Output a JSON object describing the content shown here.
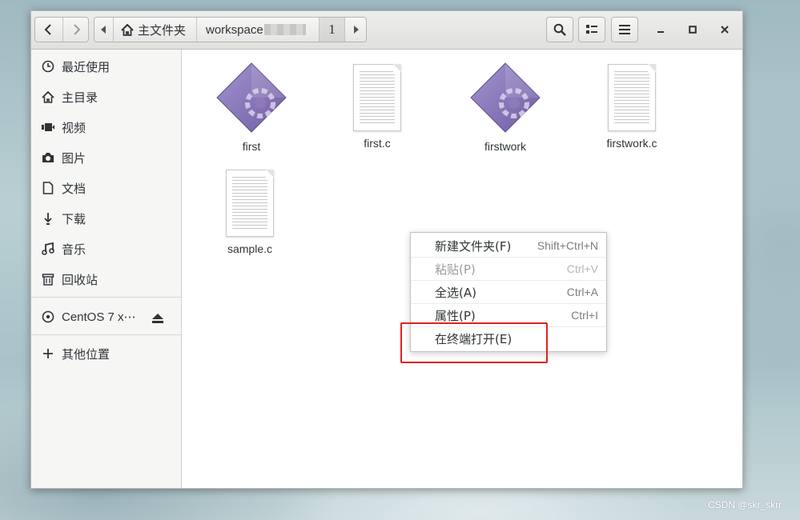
{
  "headerbar": {
    "back_icon": "chevron-left-icon",
    "forward_icon": "chevron-right-icon",
    "path": [
      {
        "label": "主文件夹",
        "icon": "home-icon"
      },
      {
        "label": "workspace"
      },
      {
        "label": "1"
      }
    ],
    "search_icon": "search-icon",
    "view_icon": "list-view-icon",
    "menu_icon": "hamburger-menu-icon",
    "minimize_icon": "minimize-icon",
    "maximize_icon": "maximize-icon",
    "close_icon": "close-icon"
  },
  "sidebar": {
    "items": [
      {
        "label": "最近使用",
        "icon": "clock-icon"
      },
      {
        "label": "主目录",
        "icon": "home-icon"
      },
      {
        "label": "视频",
        "icon": "video-icon"
      },
      {
        "label": "图片",
        "icon": "camera-icon"
      },
      {
        "label": "文档",
        "icon": "document-icon"
      },
      {
        "label": "下载",
        "icon": "download-icon"
      },
      {
        "label": "音乐",
        "icon": "music-icon"
      },
      {
        "label": "回收站",
        "icon": "trash-icon"
      }
    ],
    "devices": [
      {
        "label": "CentOS 7 x⋯",
        "icon": "disc-icon",
        "action_icon": "eject-icon"
      }
    ],
    "other": {
      "label": "其他位置",
      "icon": "plus-icon"
    }
  },
  "files": [
    {
      "name": "first",
      "type": "executable"
    },
    {
      "name": "first.c",
      "type": "text"
    },
    {
      "name": "firstwork",
      "type": "executable"
    },
    {
      "name": "firstwork.c",
      "type": "text"
    },
    {
      "name": "sample.c",
      "type": "text"
    }
  ],
  "context_menu": {
    "items": [
      {
        "label": "新建文件夹(F)",
        "shortcut": "Shift+Ctrl+N",
        "enabled": true
      },
      {
        "label": "粘贴(P)",
        "shortcut": "Ctrl+V",
        "enabled": false
      },
      {
        "label": "全选(A)",
        "shortcut": "Ctrl+A",
        "enabled": true
      },
      {
        "label": "属性(P)",
        "shortcut": "Ctrl+I",
        "enabled": true
      },
      {
        "label": "在终端打开(E)",
        "shortcut": "",
        "enabled": true
      }
    ]
  },
  "colors": {
    "highlight_box": "#e02020",
    "exec_icon": "#8c7bb8"
  },
  "watermark": "CSDN @skr_skrr"
}
